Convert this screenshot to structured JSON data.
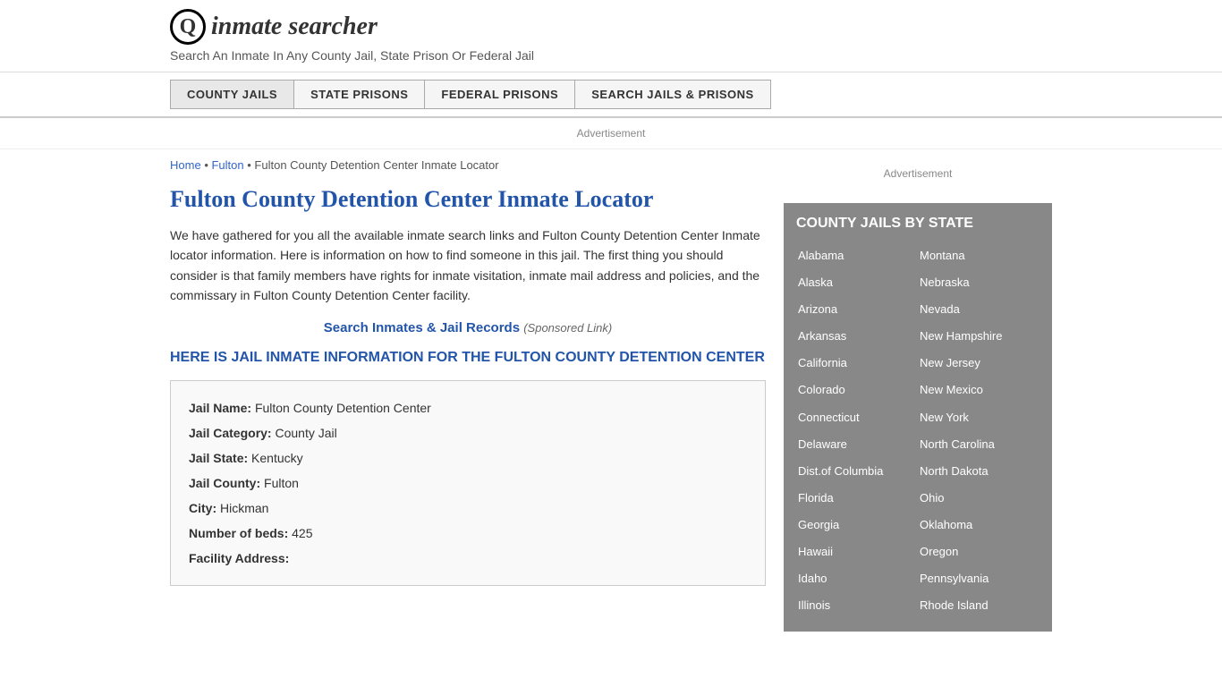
{
  "header": {
    "logo_icon": "Q",
    "logo_text": "inmate searcher",
    "tagline": "Search An Inmate In Any County Jail, State Prison Or Federal Jail"
  },
  "nav": {
    "items": [
      {
        "label": "COUNTY JAILS",
        "active": true
      },
      {
        "label": "STATE PRISONS",
        "active": false
      },
      {
        "label": "FEDERAL PRISONS",
        "active": false
      },
      {
        "label": "SEARCH JAILS & PRISONS",
        "active": false
      }
    ]
  },
  "ad": {
    "label": "Advertisement"
  },
  "breadcrumb": {
    "home": "Home",
    "fulton": "Fulton",
    "current": "Fulton County Detention Center Inmate Locator"
  },
  "page": {
    "title": "Fulton County Detention Center Inmate Locator",
    "body_text": "We have gathered for you all the available inmate search links and Fulton County Detention Center Inmate locator information. Here is information on how to find someone in this jail. The first thing you should consider is that family members have rights for inmate visitation, inmate mail address and policies, and the commissary in Fulton County Detention Center facility.",
    "sponsored_link_text": "Search Inmates & Jail Records",
    "sponsored_link_suffix": "(Sponsored Link)",
    "jail_info_heading": "HERE IS JAIL INMATE INFORMATION FOR THE FULTON COUNTY DETENTION CENTER"
  },
  "jail_details": {
    "name_label": "Jail Name:",
    "name_value": "Fulton County Detention Center",
    "category_label": "Jail Category:",
    "category_value": "County Jail",
    "state_label": "Jail State:",
    "state_value": "Kentucky",
    "county_label": "Jail County:",
    "county_value": "Fulton",
    "city_label": "City:",
    "city_value": "Hickman",
    "beds_label": "Number of beds:",
    "beds_value": "425",
    "address_label": "Facility Address:"
  },
  "sidebar": {
    "ad_label": "Advertisement",
    "state_box_title": "COUNTY JAILS BY STATE",
    "states_left": [
      "Alabama",
      "Alaska",
      "Arizona",
      "Arkansas",
      "California",
      "Colorado",
      "Connecticut",
      "Delaware",
      "Dist.of Columbia",
      "Florida",
      "Georgia",
      "Hawaii",
      "Idaho",
      "Illinois"
    ],
    "states_right": [
      "Montana",
      "Nebraska",
      "Nevada",
      "New Hampshire",
      "New Jersey",
      "New Mexico",
      "New York",
      "North Carolina",
      "North Dakota",
      "Ohio",
      "Oklahoma",
      "Oregon",
      "Pennsylvania",
      "Rhode Island"
    ]
  }
}
